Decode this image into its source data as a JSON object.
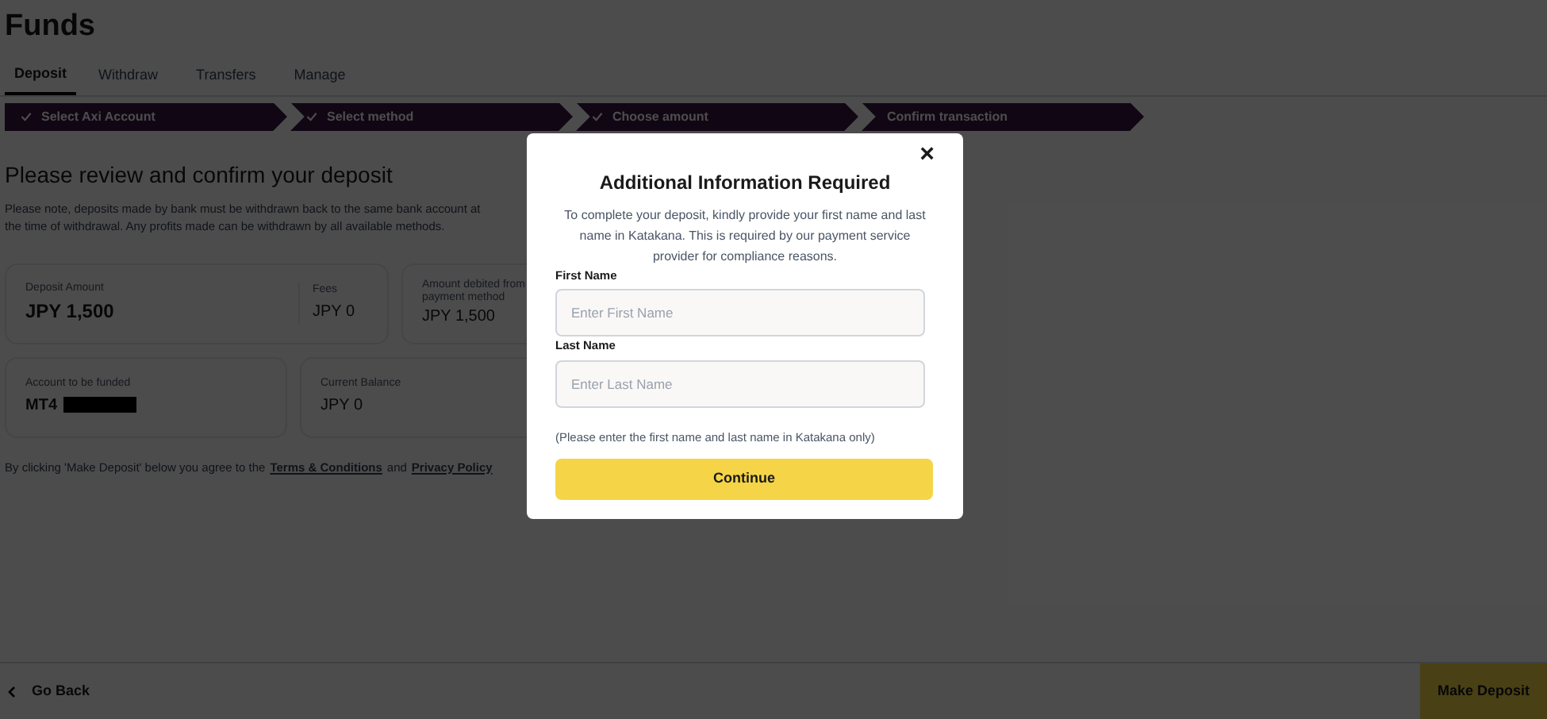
{
  "page": {
    "title": "Funds"
  },
  "tabs": [
    {
      "label": "Deposit",
      "selected": true
    },
    {
      "label": "Withdraw",
      "selected": false
    },
    {
      "label": "Transfers",
      "selected": false
    },
    {
      "label": "Manage",
      "selected": false
    }
  ],
  "steps": [
    {
      "label": "Select Axi Account",
      "done": true
    },
    {
      "label": "Select method",
      "done": true
    },
    {
      "label": "Choose amount",
      "done": true
    },
    {
      "label": "Confirm transaction",
      "done": false
    }
  ],
  "review": {
    "heading": "Please review and confirm your deposit",
    "note": "Please note, deposits made by bank must be withdrawn back to the same bank account at the time of withdrawal. Any profits made can be withdrawn by all available methods.",
    "deposit_amount": {
      "label": "Deposit Amount",
      "value": "JPY 1,500"
    },
    "fees": {
      "label": "Fees",
      "value": "JPY 0"
    },
    "amount_debited": {
      "label": "Amount debited from payment method",
      "value": "JPY 1,500"
    },
    "account": {
      "label": "Account to be funded",
      "value": "MT4",
      "redacted": true
    },
    "balance": {
      "label": "Current Balance",
      "value": "JPY 0"
    },
    "agreement": {
      "before": "By clicking 'Make Deposit' below you agree to the",
      "terms": "Terms & Conditions",
      "and": "and",
      "privacy": "Privacy Policy"
    }
  },
  "footer": {
    "back": "Go Back",
    "submit": "Make Deposit"
  },
  "modal": {
    "close": "×",
    "title": "Additional Information Required",
    "text": "To complete your deposit, kindly provide your first name and last name in Katakana. This is required by our payment service provider for compliance reasons.",
    "fields": [
      {
        "label": "First Name",
        "placeholder": "Enter First Name"
      },
      {
        "label": "Last Name",
        "placeholder": "Enter Last Name"
      }
    ],
    "hint": "(Please enter the first name and last name in Katakana only)",
    "button": "Continue"
  }
}
